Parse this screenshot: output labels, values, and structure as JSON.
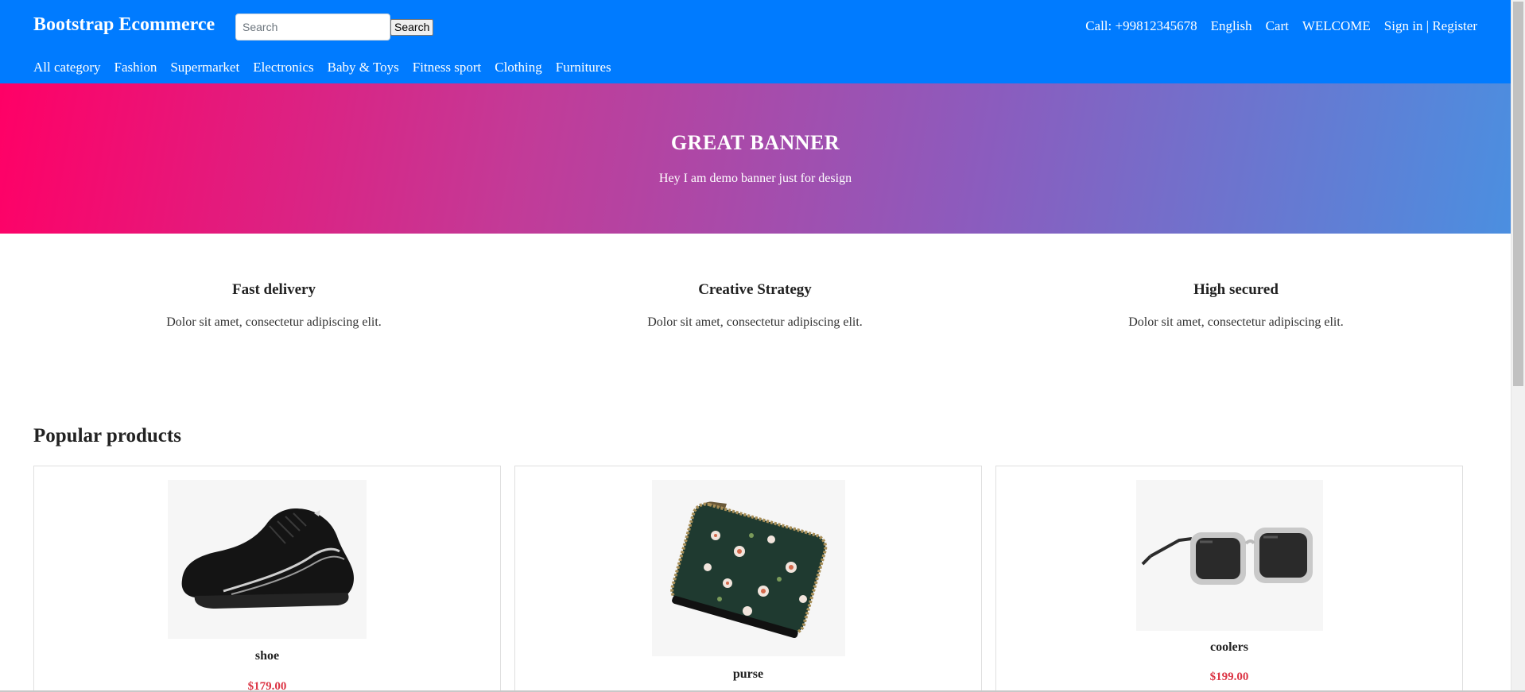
{
  "header": {
    "brand": "Bootstrap Ecommerce",
    "search_placeholder": "Search",
    "search_button": "Search",
    "links": [
      "Call: +99812345678",
      "English",
      "Cart",
      "WELCOME",
      "Sign in | Register"
    ],
    "categories": [
      "All category",
      "Fashion",
      "Supermarket",
      "Electronics",
      "Baby & Toys",
      "Fitness sport",
      "Clothing",
      "Furnitures"
    ]
  },
  "banner": {
    "title": "GREAT BANNER",
    "subtitle": "Hey I am demo banner just for design"
  },
  "features": [
    {
      "title": "Fast delivery",
      "description": "Dolor sit amet, consectetur adipiscing elit."
    },
    {
      "title": "Creative Strategy",
      "description": "Dolor sit amet, consectetur adipiscing elit."
    },
    {
      "title": "High secured",
      "description": "Dolor sit amet, consectetur adipiscing elit."
    }
  ],
  "products_section": {
    "title": "Popular products",
    "items": [
      {
        "name": "shoe",
        "price": "$179.00",
        "image_icon": "shoe-image"
      },
      {
        "name": "purse",
        "price": "",
        "image_icon": "purse-image"
      },
      {
        "name": "coolers",
        "price": "$199.00",
        "image_icon": "sunglasses-image"
      }
    ]
  },
  "colors": {
    "header_bg": "#007bff",
    "price": "#dc3545",
    "banner_gradient_start": "#ff0066",
    "banner_gradient_end": "#4b8fe0"
  }
}
